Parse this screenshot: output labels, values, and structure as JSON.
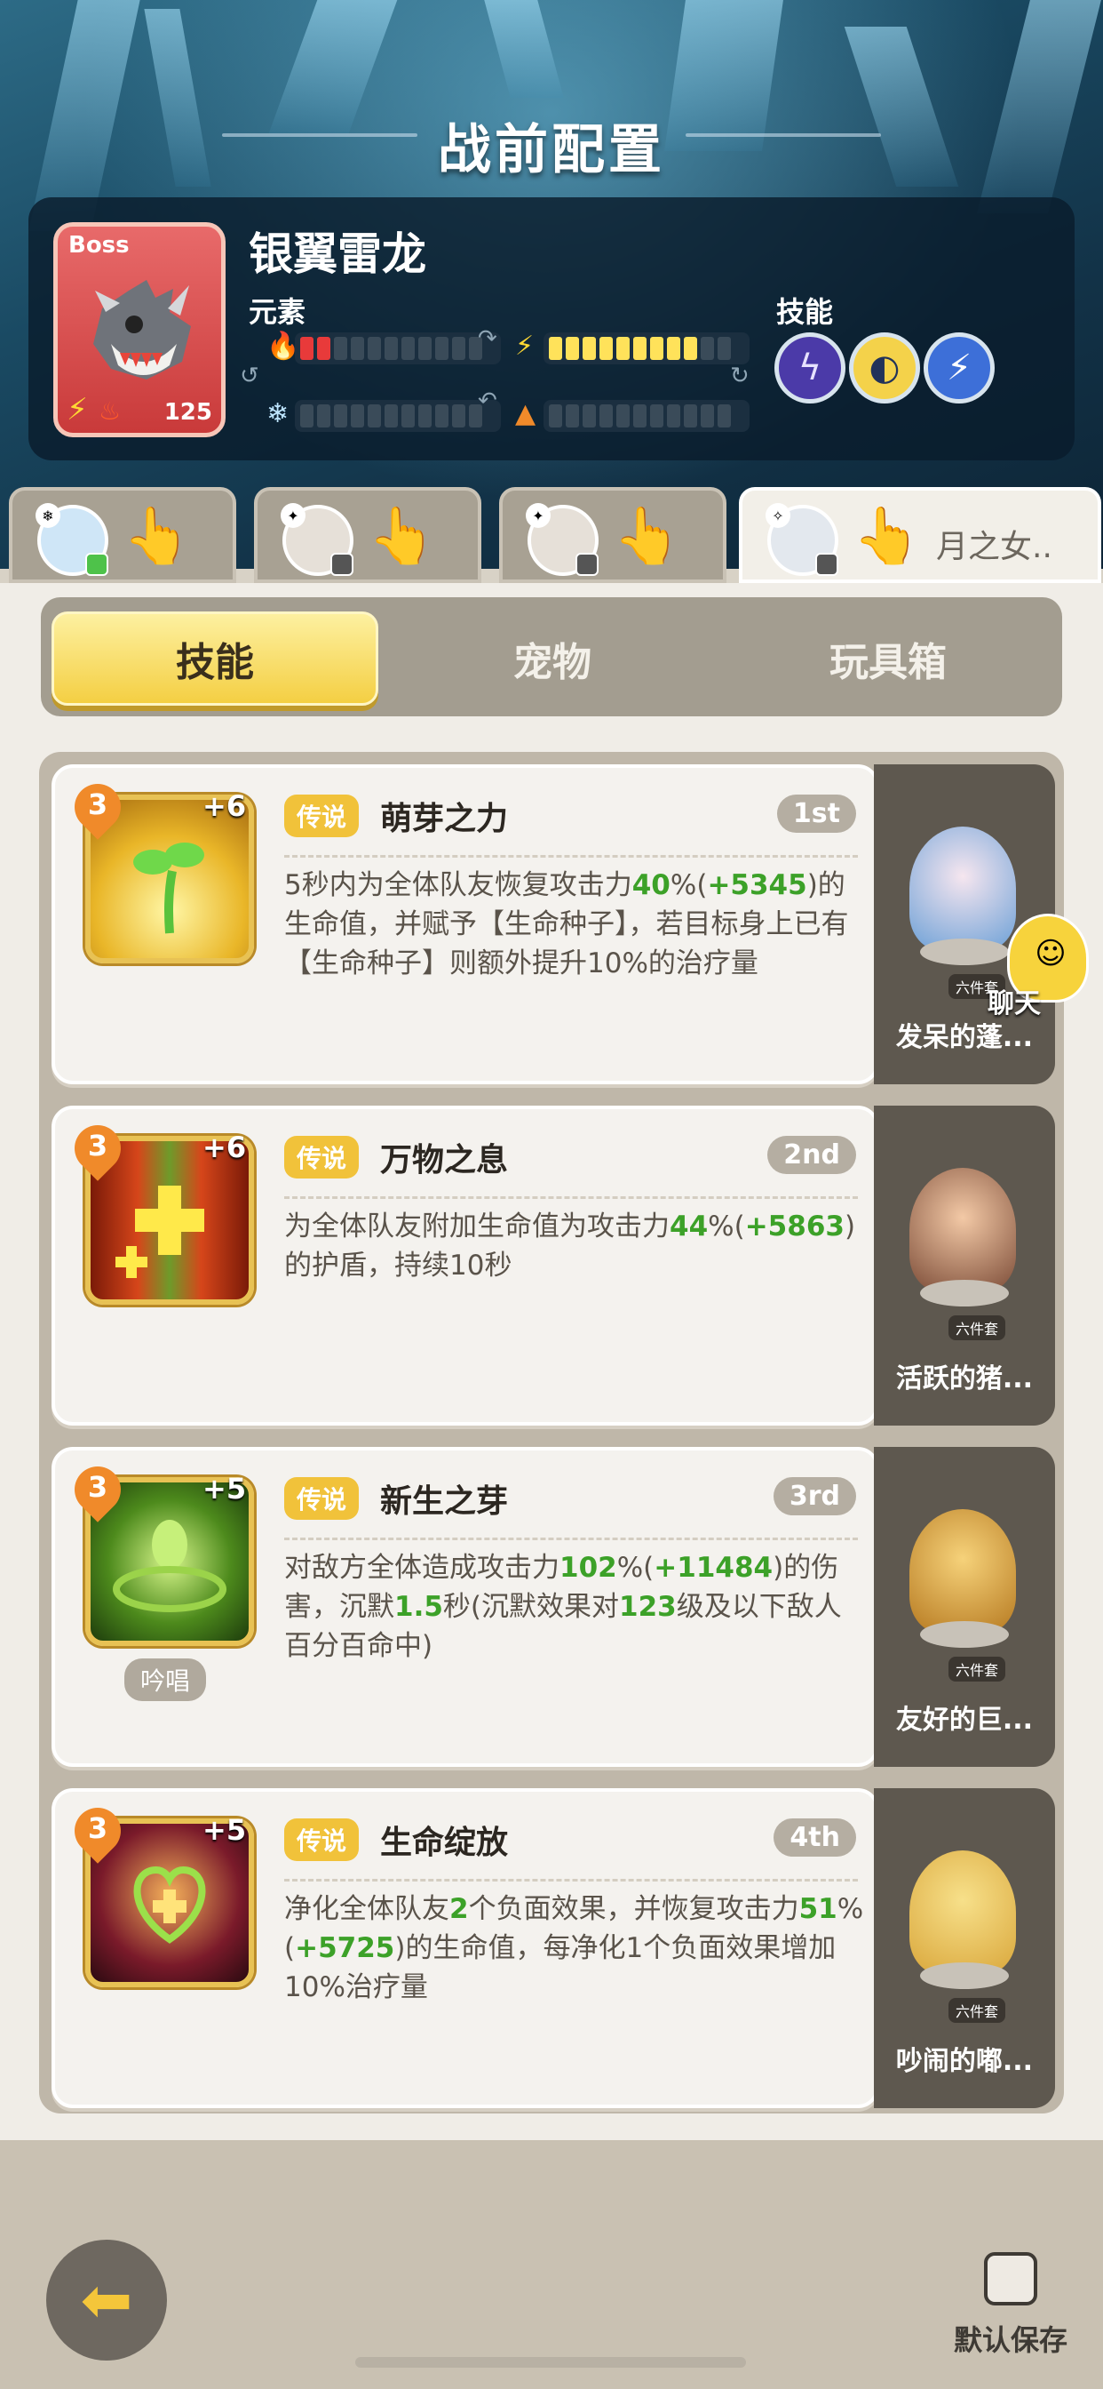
{
  "header": {
    "title": "战前配置"
  },
  "boss": {
    "tag": "Boss",
    "level": "125",
    "name": "银翼雷龙",
    "element_label": "元素",
    "skill_label": "技能",
    "elements": [
      {
        "icon": "fire-icon",
        "filled": 2,
        "color": "#e83a3a"
      },
      {
        "icon": "lightning-icon",
        "filled": 9,
        "color": "#ffe25a"
      },
      {
        "icon": "snowflake-icon",
        "filled": 0,
        "color": "#3a4b59"
      },
      {
        "icon": "earth-icon",
        "filled": 0,
        "color": "#3a4b59"
      }
    ],
    "skills": [
      {
        "icon": "storm-skill-icon"
      },
      {
        "icon": "dash-skill-icon"
      },
      {
        "icon": "lightning-skill-icon"
      }
    ]
  },
  "hero_tabs": [
    {
      "name": "",
      "avatar_badge": "green"
    },
    {
      "name": "",
      "avatar_badge": "gray"
    },
    {
      "name": "",
      "avatar_badge": "gray"
    },
    {
      "name": "月之女..",
      "avatar_badge": "gray",
      "active": true
    }
  ],
  "category_tabs": [
    "技能",
    "宠物",
    "玩具箱"
  ],
  "skills": [
    {
      "rank": "3",
      "plus": "+6",
      "tag": "传说",
      "name": "萌芽之力",
      "order": "1st",
      "desc_parts": [
        "5秒内为全体队友恢复攻击力",
        "40",
        "%(",
        "+5345",
        ")的生命值，并赋予【生命种子】，若目标身上已有【生命种子】则额外提升10%的治疗量"
      ],
      "side_name": "发呆的蓬...",
      "side_set": "六件套",
      "icon_color": "#f6e14a"
    },
    {
      "rank": "3",
      "plus": "+6",
      "tag": "传说",
      "name": "万物之息",
      "order": "2nd",
      "desc_parts": [
        "为全体队友附加生命值为攻击力",
        "44",
        "%(",
        "+5863",
        ")的护盾，持续10秒"
      ],
      "side_name": "活跃的猪...",
      "side_set": "六件套",
      "icon_color": "#c44a1e"
    },
    {
      "rank": "3",
      "plus": "+5",
      "tag": "传说",
      "name": "新生之芽",
      "order": "3rd",
      "chant": "吟唱",
      "desc_parts": [
        "对敌方全体造成攻击力",
        "102",
        "%(",
        "+11484",
        ")的伤害，沉默",
        "1.5",
        "秒(沉默效果对",
        "123",
        "级及以下敌人百分百命中)"
      ],
      "side_name": "友好的巨...",
      "side_set": "六件套",
      "icon_color": "#6fb83c"
    },
    {
      "rank": "3",
      "plus": "+5",
      "tag": "传说",
      "name": "生命绽放",
      "order": "4th",
      "desc_parts": [
        "净化全体队友",
        "2",
        "个负面效果，并恢复攻击力",
        "51",
        "%(",
        "+5725",
        ")的生命值，每净化1个负面效果增加10%治疗量"
      ],
      "side_name": "吵闹的嘟...",
      "side_set": "六件套",
      "icon_color": "#d4573a"
    }
  ],
  "chat": {
    "label": "聊天"
  },
  "footer": {
    "save_label": "默认保存"
  }
}
